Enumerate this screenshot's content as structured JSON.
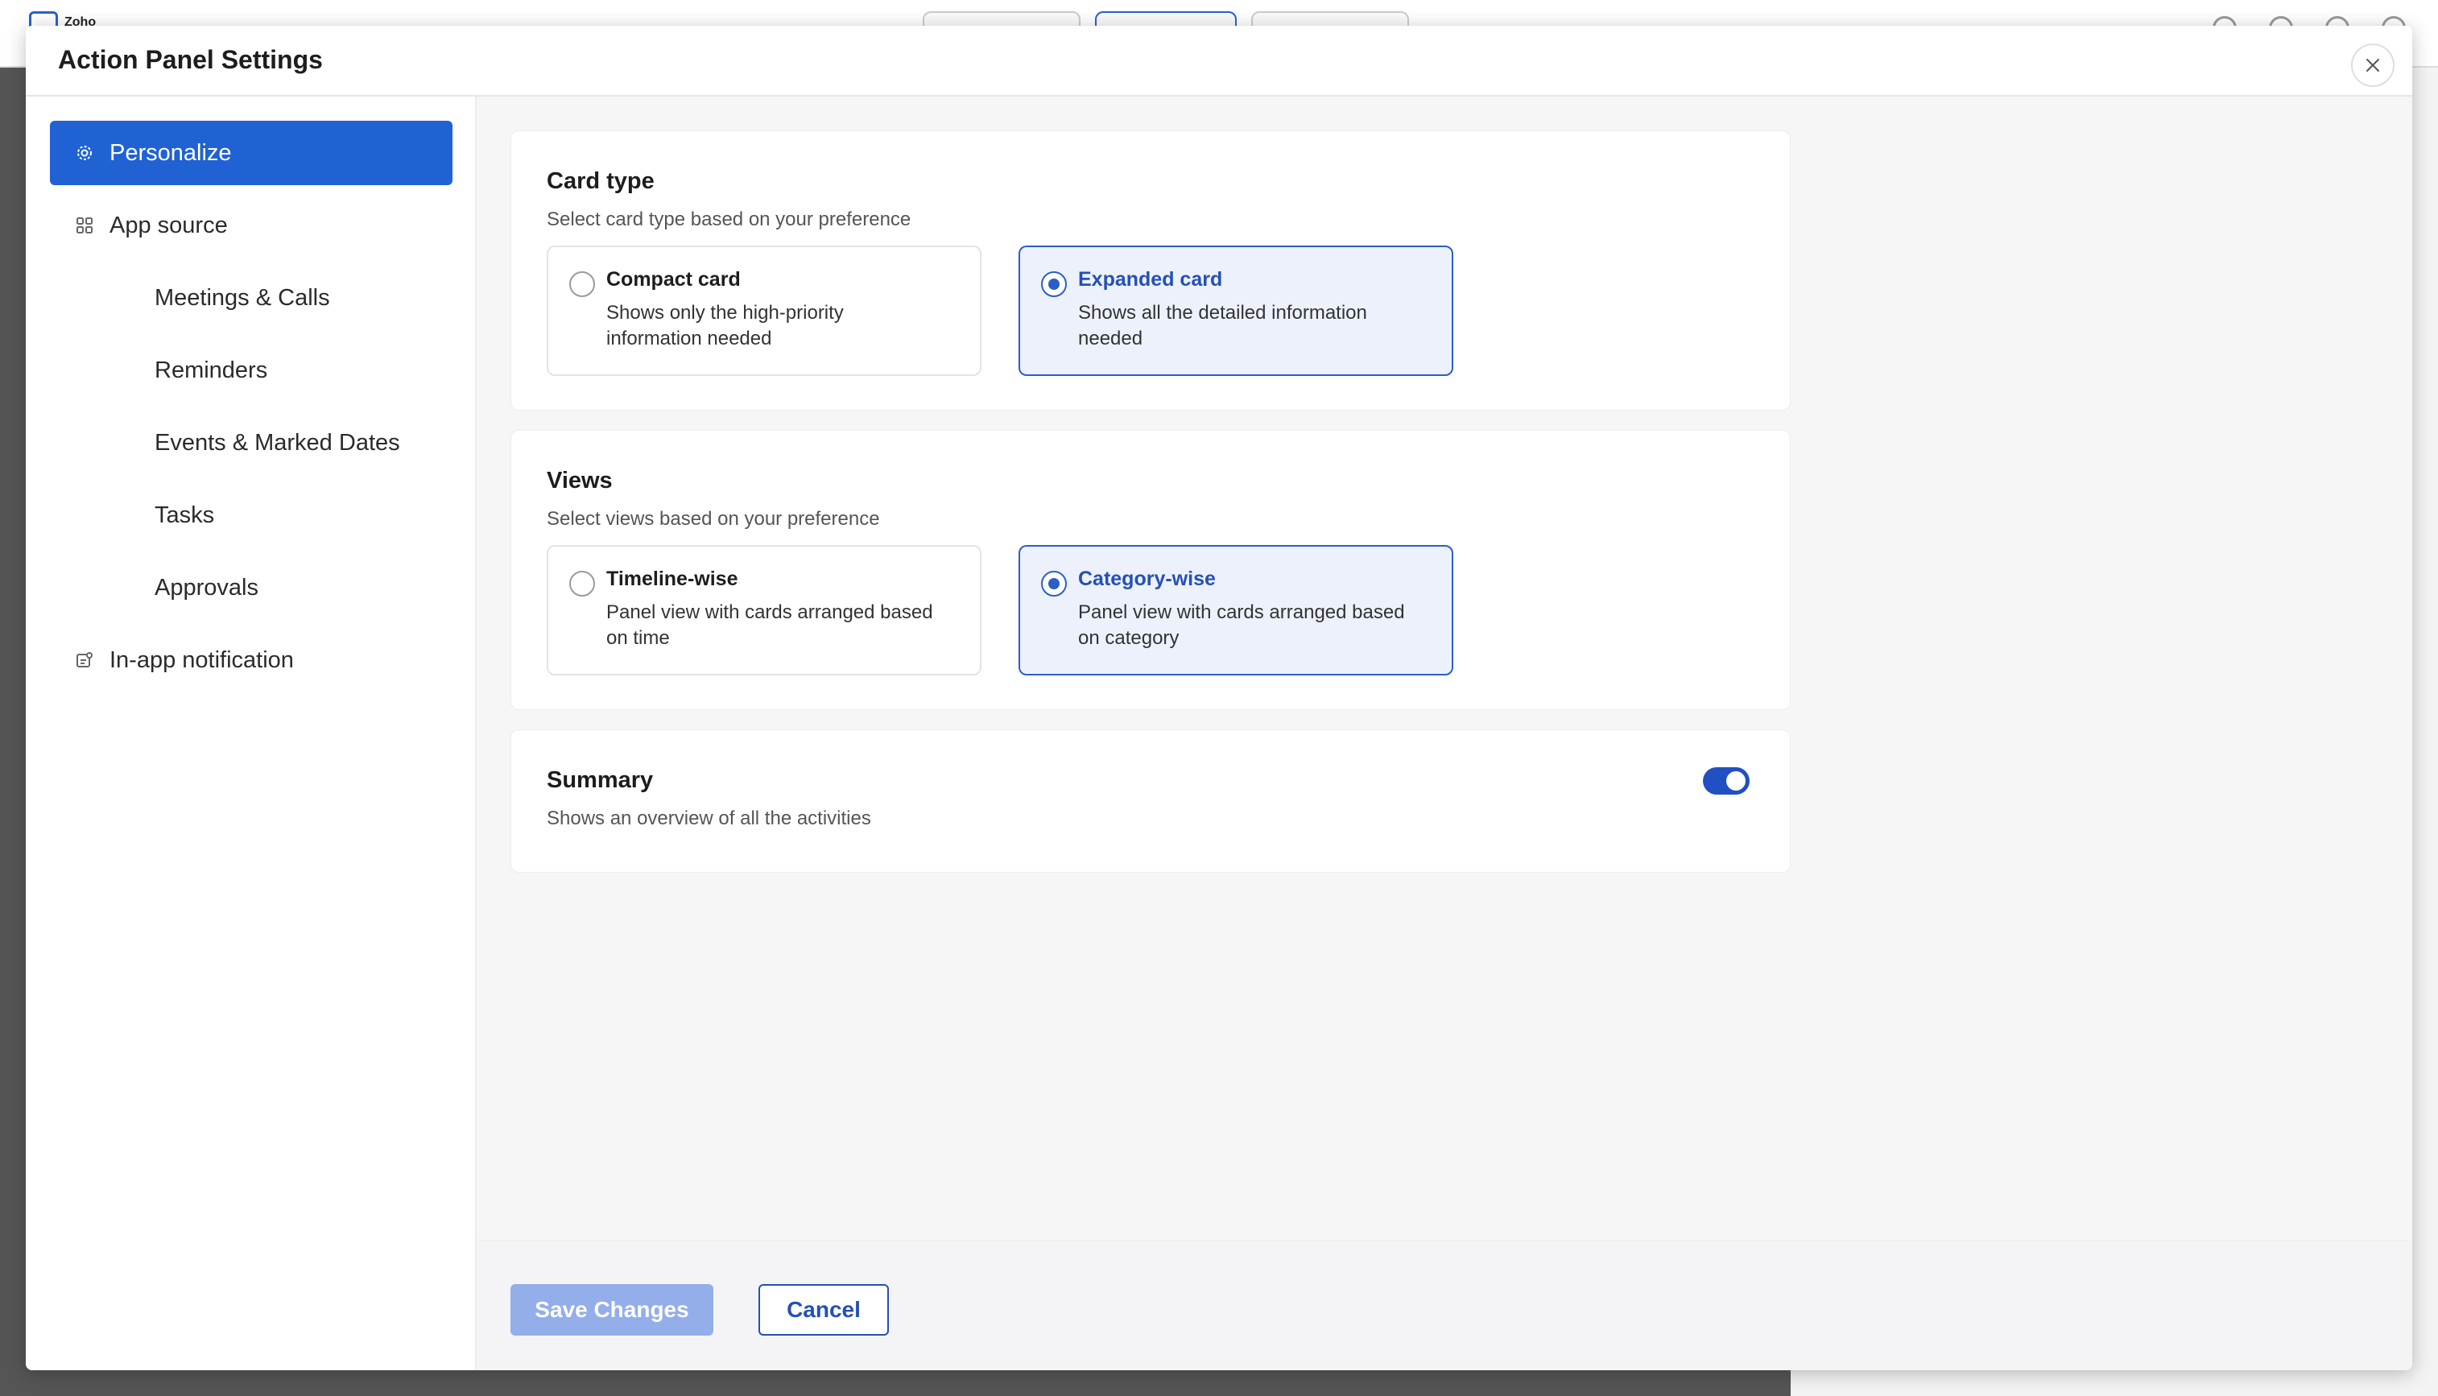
{
  "background": {
    "logo_text": "Zoho"
  },
  "modal": {
    "title": "Action Panel Settings"
  },
  "sidebar": {
    "items": [
      {
        "label": "Personalize",
        "icon": "gear-icon",
        "active": true
      },
      {
        "label": "App source",
        "icon": "grid-icon",
        "active": false
      },
      {
        "label": "Meetings & Calls",
        "sub": true
      },
      {
        "label": "Reminders",
        "sub": true
      },
      {
        "label": "Events & Marked Dates",
        "sub": true
      },
      {
        "label": "Tasks",
        "sub": true
      },
      {
        "label": "Approvals",
        "sub": true
      },
      {
        "label": "In-app notification",
        "icon": "notification-icon",
        "active": false
      }
    ]
  },
  "card_type": {
    "title": "Card type",
    "subtitle": "Select card type based on your preference",
    "options": [
      {
        "title": "Compact card",
        "desc": "Shows only the high-priority information needed",
        "selected": false
      },
      {
        "title": "Expanded card",
        "desc": "Shows all the detailed information needed",
        "selected": true
      }
    ]
  },
  "views": {
    "title": "Views",
    "subtitle": "Select views based on your preference",
    "options": [
      {
        "title": "Timeline-wise",
        "desc": "Panel view with cards arranged based on time",
        "selected": false
      },
      {
        "title": "Category-wise",
        "desc": "Panel view with cards arranged based on category",
        "selected": true
      }
    ]
  },
  "summary": {
    "title": "Summary",
    "subtitle": "Shows an overview of all the activities",
    "enabled": true
  },
  "footer": {
    "save_label": "Save Changes",
    "cancel_label": "Cancel"
  },
  "colors": {
    "accent": "#2062d3",
    "selected_border": "#2b5fc4",
    "selected_bg": "#ecf1fc",
    "save_disabled": "#93aee9"
  }
}
